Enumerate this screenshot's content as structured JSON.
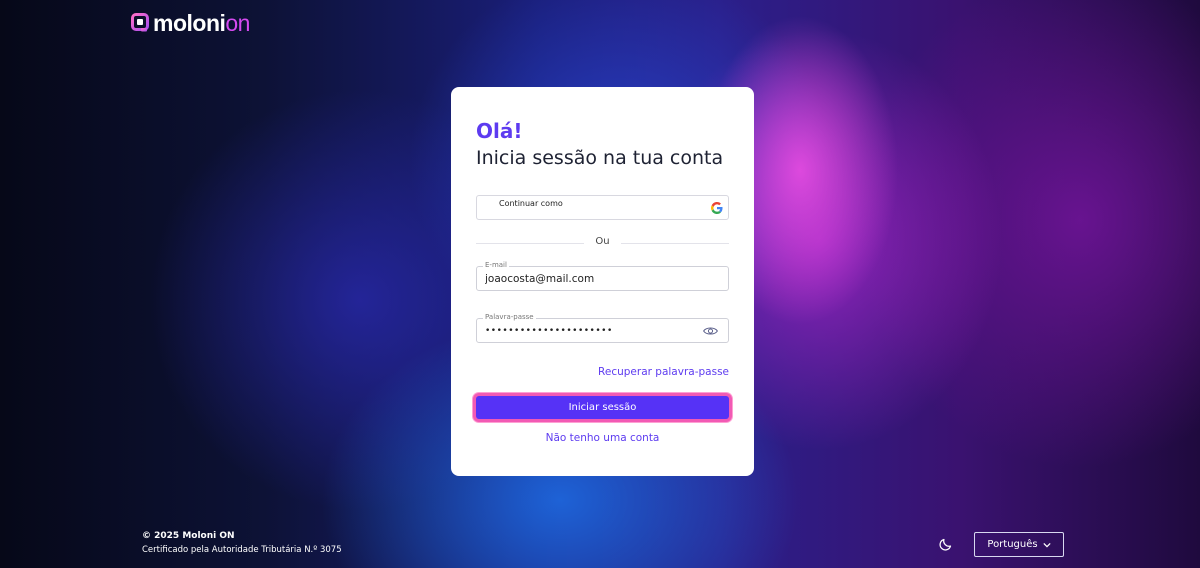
{
  "brand": {
    "name_part1": "moloni",
    "name_part2": "on",
    "accent_color": "#d54af0"
  },
  "card": {
    "greeting": "Olá!",
    "title": "Inicia sessão na tua conta",
    "google_button": {
      "label": "Continuar como",
      "icon": "google-icon"
    },
    "divider_text": "Ou",
    "email": {
      "label": "E-mail",
      "value": "joaocosta@mail.com"
    },
    "password": {
      "label": "Palavra-passe",
      "value": "••••••••••••••••••••••",
      "icon": "eye-icon"
    },
    "recover_link": "Recuperar palavra-passe",
    "login_button": "Iniciar sessão",
    "no_account_link": "Não tenho uma conta",
    "primary_color": "#5632f6"
  },
  "footer": {
    "copyright": "© 2025 Moloni ON",
    "certification": "Certificado pela Autoridade Tributária N.º 3075",
    "theme_icon": "moon-icon",
    "language": "Português"
  }
}
